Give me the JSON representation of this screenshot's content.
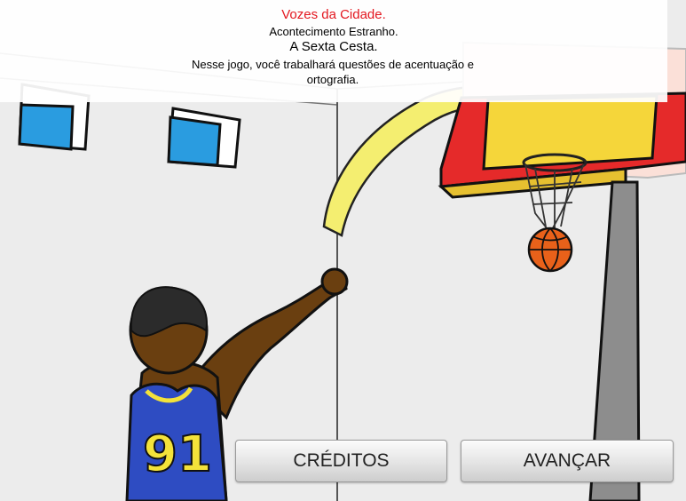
{
  "header": {
    "title": "Vozes da Cidade.",
    "subtitle": "Acontecimento Estranho.",
    "heading": "A Sexta Cesta.",
    "description": "Nesse jogo, você trabalhará questões de acentuação e ortografia."
  },
  "player": {
    "jersey_number": "91"
  },
  "buttons": {
    "credits_label": "CRÉDITOS",
    "next_label": "AVANÇAR"
  },
  "colors": {
    "title_red": "#e3171f",
    "backboard_red": "#e52a2a",
    "backboard_yellow": "#f5d63a",
    "jersey_blue": "#2e4cc2",
    "jersey_yellow": "#f3e23a",
    "ball_orange": "#e8611a",
    "window_blue": "#2a9ce0"
  }
}
